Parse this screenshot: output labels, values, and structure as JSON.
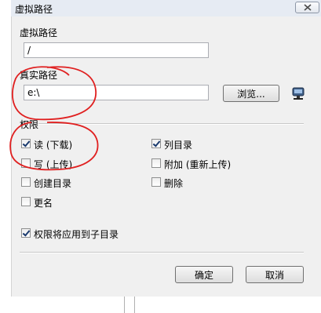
{
  "window": {
    "title": "虚拟路径",
    "close_icon": "close-icon"
  },
  "virtual_path": {
    "label": "虚拟路径",
    "value": "/"
  },
  "real_path": {
    "label": "真实路径",
    "value": "e:\\",
    "browse_label": "浏览...",
    "network_icon": "network-drive-icon"
  },
  "permissions": {
    "label": "权限",
    "items": [
      {
        "label": "读 (下载)",
        "checked": true
      },
      {
        "label": "列目录",
        "checked": true
      },
      {
        "label": "写 (上传)",
        "checked": false
      },
      {
        "label": "附加 (重新上传)",
        "checked": false
      },
      {
        "label": "创建目录",
        "checked": false
      },
      {
        "label": "删除",
        "checked": false
      },
      {
        "label": "更名",
        "checked": false
      }
    ],
    "apply_subdirs": {
      "label": "权限将应用到子目录",
      "checked": true
    }
  },
  "buttons": {
    "ok": "确定",
    "cancel": "取消"
  },
  "colors": {
    "annotation": "#e02020",
    "title_bg": "#e6ebf3",
    "dialog_bg": "#f0f0f0"
  }
}
